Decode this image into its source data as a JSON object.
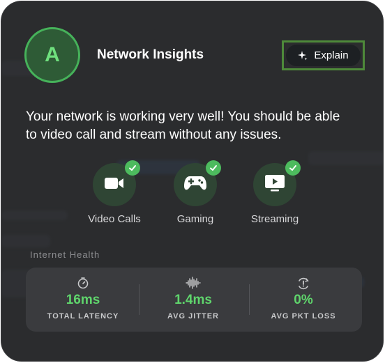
{
  "header": {
    "avatar_letter": "A",
    "title": "Network Insights",
    "explain_label": "Explain"
  },
  "message": "Your network is working very well! You should be able to video call and stream without any issues.",
  "features": [
    {
      "label": "Video Calls",
      "icon": "video-camera-icon",
      "status": "ok"
    },
    {
      "label": "Gaming",
      "icon": "gamepad-icon",
      "status": "ok"
    },
    {
      "label": "Streaming",
      "icon": "tv-play-icon",
      "status": "ok"
    }
  ],
  "health": {
    "title": "Internet Health",
    "metrics": [
      {
        "value": "16ms",
        "label": "TOTAL LATENCY",
        "icon": "timer-icon"
      },
      {
        "value": "1.4ms",
        "label": "AVG JITTER",
        "icon": "waveform-icon"
      },
      {
        "value": "0%",
        "label": "AVG PKT LOSS",
        "icon": "packet-loss-icon"
      }
    ]
  },
  "colors": {
    "accent_green": "#5fd56c",
    "card_bg": "#2b2c2e",
    "explain_highlight": "#4e8a3a"
  }
}
